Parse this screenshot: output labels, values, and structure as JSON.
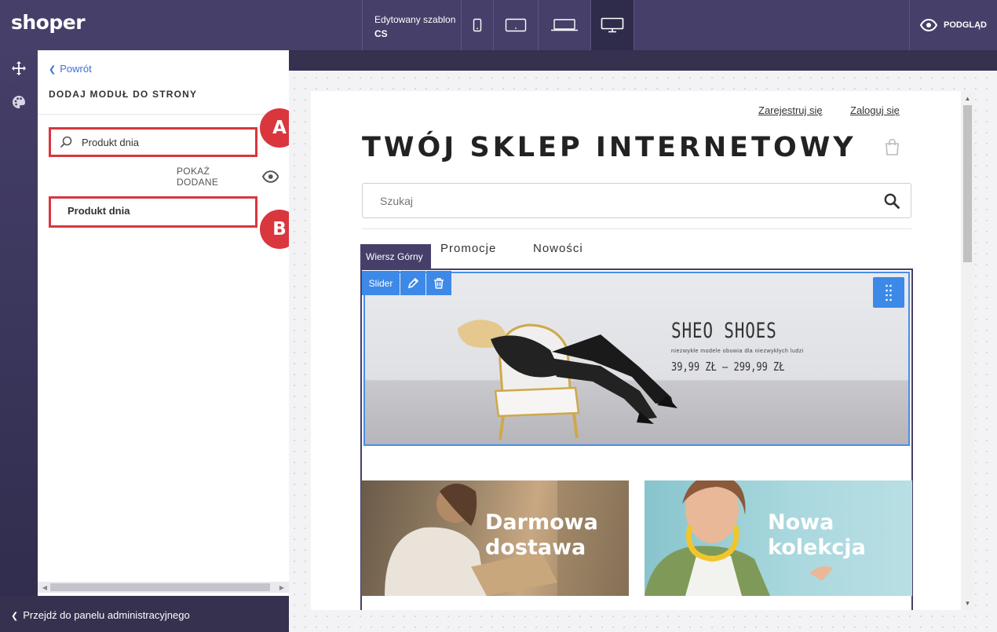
{
  "app": {
    "logo": "shoper",
    "template_label": "Edytowany szablon",
    "template_name": "CS",
    "preview_label": "PODGLĄD",
    "devices": [
      "mobile-view",
      "tablet-view",
      "laptop-view",
      "desktop-view"
    ],
    "active_device": "desktop-view",
    "accent_color": "#453f69",
    "annotation_color": "#d9363e"
  },
  "rail": {
    "icons": [
      "move-icon",
      "palette-icon"
    ]
  },
  "panel": {
    "back_label": "Powrót",
    "title": "DODAJ MODUŁ DO STRONY",
    "search_value": "Produkt dnia",
    "show_added_label": "POKAŻ DODANE",
    "results": [
      "Produkt dnia"
    ],
    "goto_admin_label": "Przejdź do panelu administracyjnego"
  },
  "annotations": {
    "a": "A",
    "b": "B"
  },
  "store": {
    "register_link": "Zarejestruj się",
    "login_link": "Zaloguj się",
    "title": "TWÓJ SKLEP INTERNETOWY",
    "search_placeholder": "Szukaj",
    "row_tag": "Wiersz Górny",
    "nav": [
      "Promocje",
      "Nowości"
    ],
    "slider_label": "Slider",
    "slide": {
      "heading": "SHEO SHOES",
      "subheading": "niezwykłe modele obuwia dla niezwykłych ludzi",
      "price": "39,99 ZŁ  –  299,99 ZŁ"
    },
    "banners": [
      {
        "line1": "Darmowa",
        "line2": "dostawa"
      },
      {
        "line1": "Nowa",
        "line2": "kolekcja"
      }
    ]
  }
}
